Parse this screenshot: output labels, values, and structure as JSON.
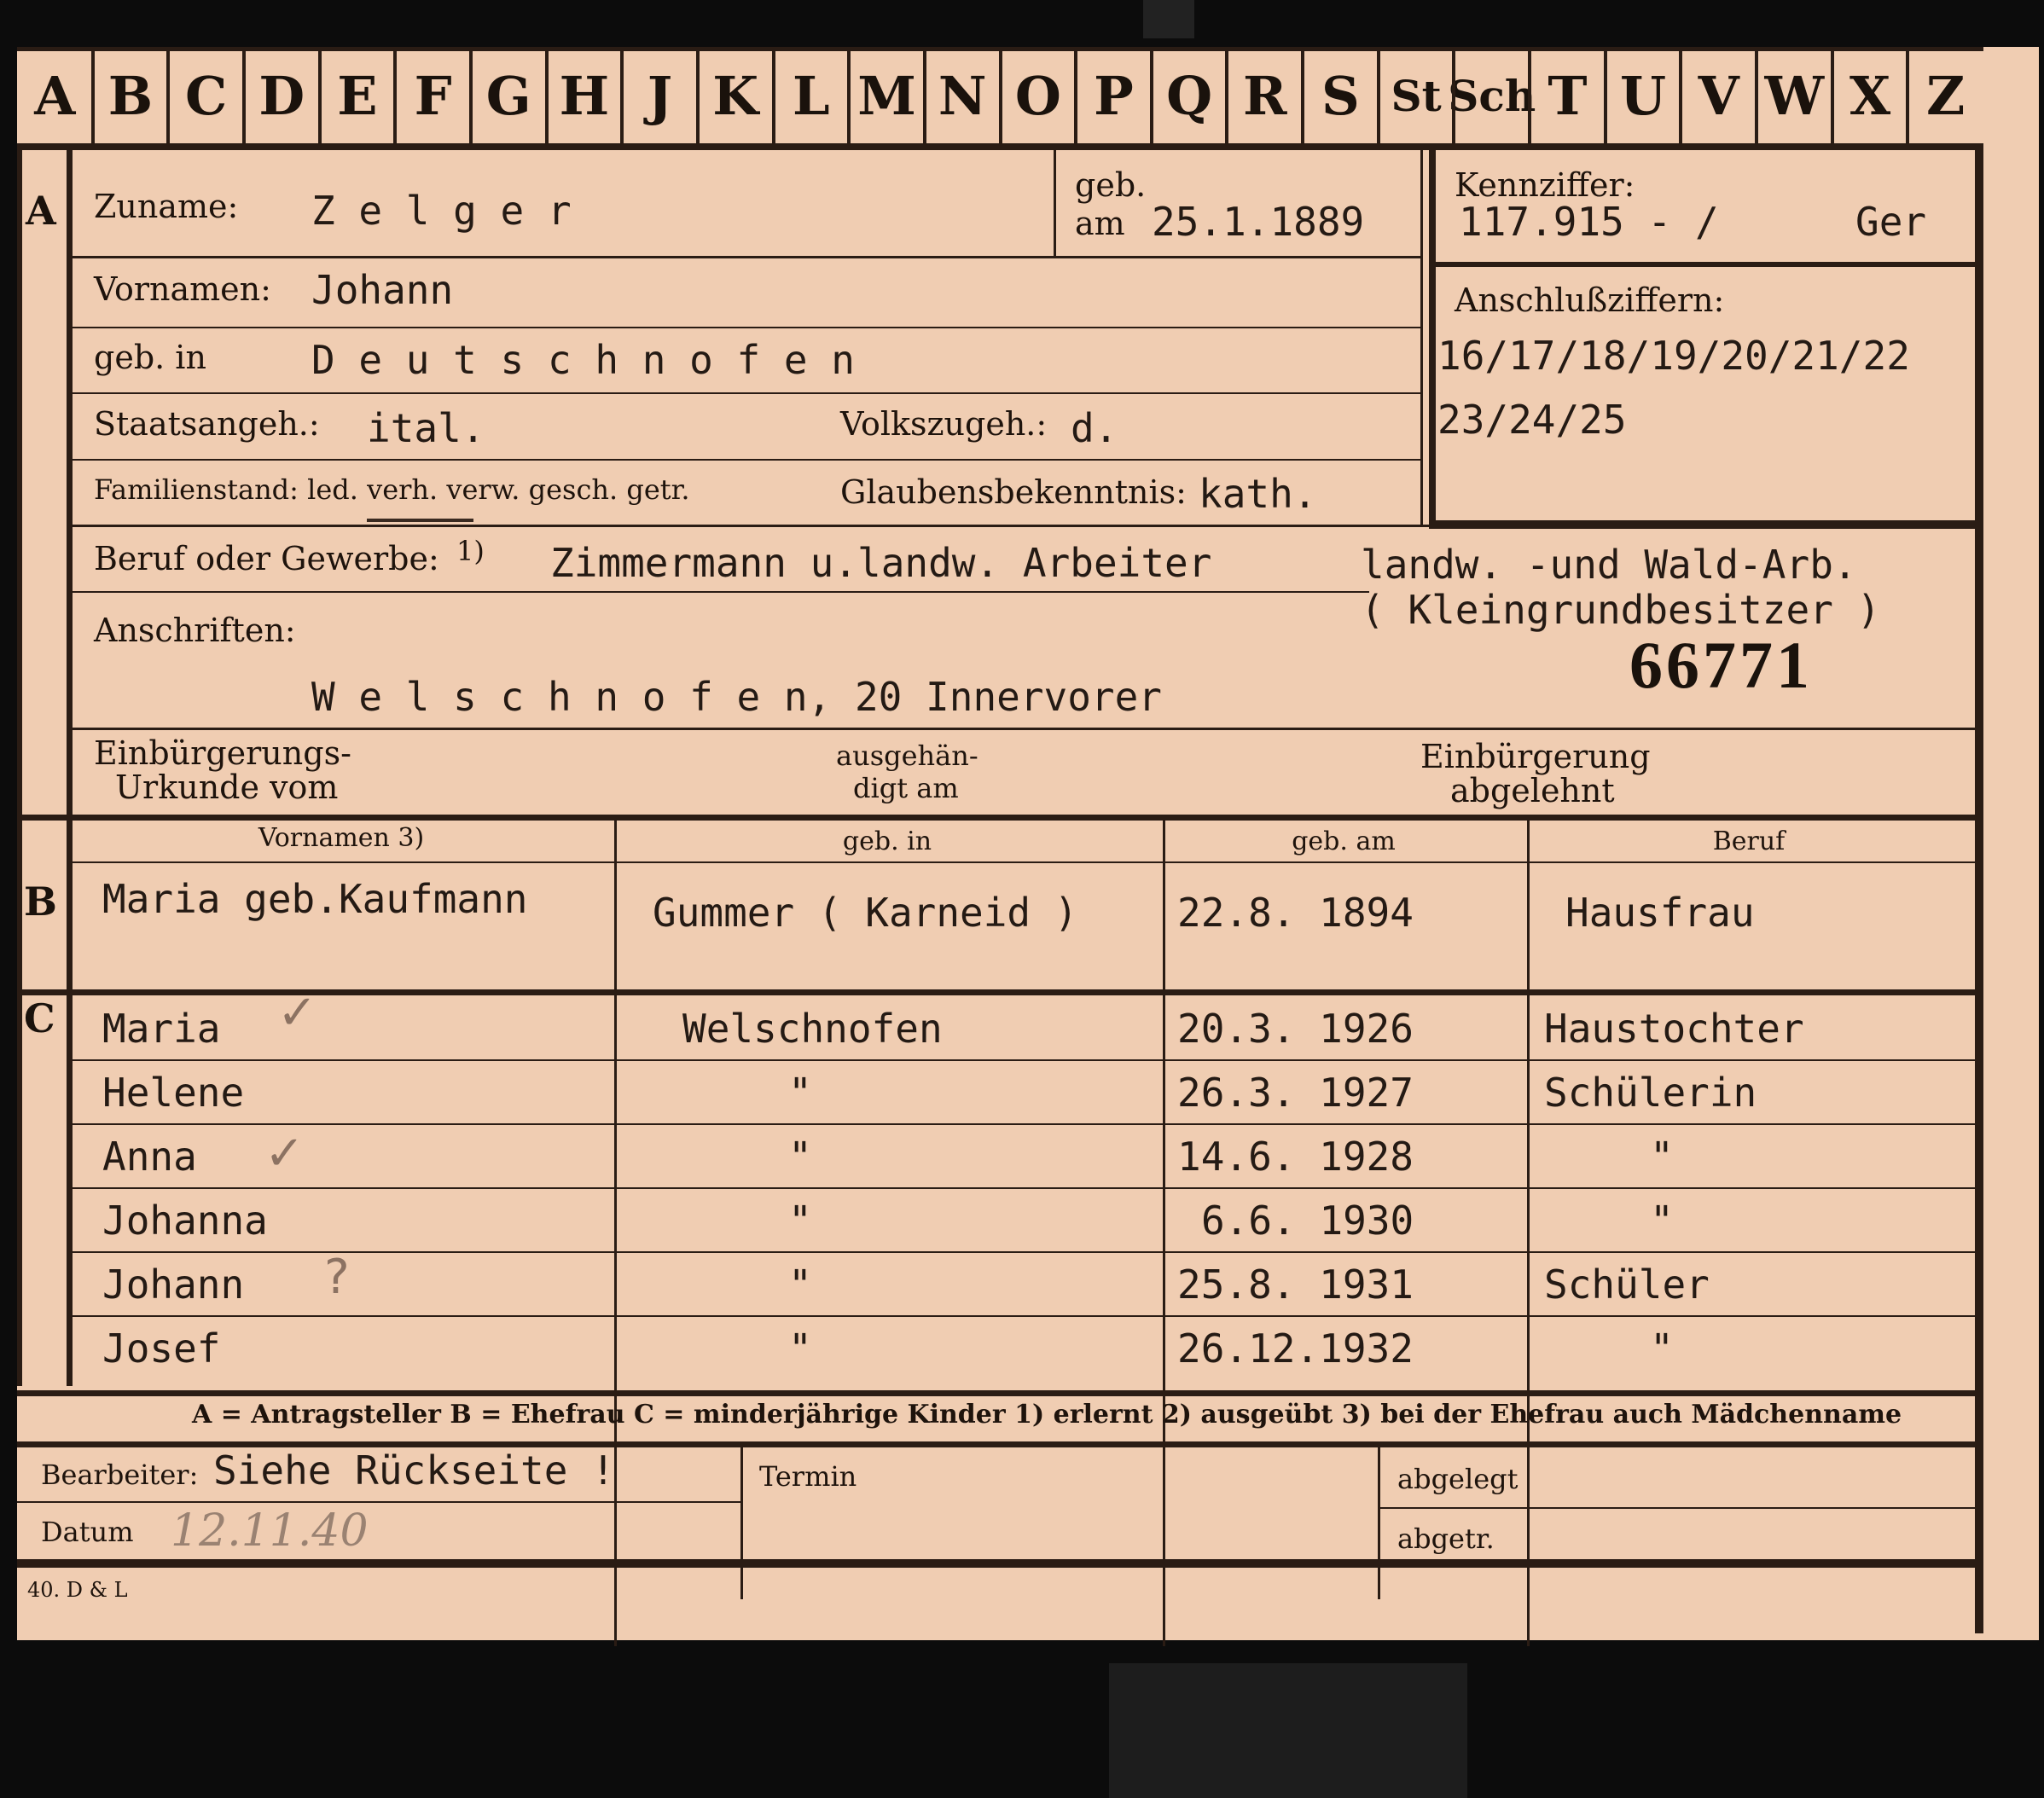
{
  "alphabet": [
    "A",
    "B",
    "C",
    "D",
    "E",
    "F",
    "G",
    "H",
    "J",
    "K",
    "L",
    "M",
    "N",
    "O",
    "P",
    "Q",
    "R",
    "S",
    "St",
    "Sch",
    "T",
    "U",
    "V",
    "W",
    "X",
    "Z"
  ],
  "section_markers": {
    "a": "A",
    "b": "B",
    "c": "C"
  },
  "applicant": {
    "surname_label": "Zuname:",
    "surname": "Z e l g e r",
    "birth_label_1": "geb.",
    "birth_label_2": "am",
    "birth_date": "25.1.1889",
    "firstname_label": "Vornamen:",
    "firstname": "Johann",
    "birthplace_label": "geb. in",
    "birthplace": "D e u t s c h n o f e n",
    "citizenship_label": "Staatsangeh.:",
    "citizenship": "ital.",
    "ethnicity_label": "Volkszugeh.:",
    "ethnicity": "d.",
    "family_label": "Familienstand: led. verh. verw. gesch. getr.",
    "religion_label": "Glaubensbekenntnis:",
    "religion": "kath.",
    "occupation_label": "Beruf oder Gewerbe:",
    "occupation_footnote": "1)",
    "occupation": "Zimmermann u.landw. Arbeiter",
    "occupation_2": "landw. -und Wald-Arb.",
    "occupation_3": "( Kleingrundbesitzer )",
    "address_label": "Anschriften:",
    "address": "W e l s c h n o f e n, 20 Innervorer",
    "number_stamp": "66771",
    "naturalization_label_1": "Einbürgerungs-",
    "naturalization_label_2": "Urkunde vom",
    "handed_label_1": "ausgehän-",
    "handed_label_2": "digt am",
    "rejected_label_1": "Einbürgerung",
    "rejected_label_2": "abgelehnt"
  },
  "ids": {
    "kennziffer_label": "Kennziffer:",
    "kennziffer": "117.915 - /",
    "kennziffer_suffix": "Ger",
    "anschluss_label": "Anschlußziffern:",
    "anschluss_1": "16/17/18/19/20/21/22",
    "anschluss_2": "23/24/25"
  },
  "table_headers": {
    "name": "Vornamen 3)",
    "place": "geb. in",
    "date": "geb. am",
    "job": "Beruf"
  },
  "spouse": {
    "name": "Maria geb.Kaufmann",
    "place": "Gummer ( Karneid )",
    "date": "22.8. 1894",
    "job": "Hausfrau"
  },
  "children": [
    {
      "name": "Maria",
      "place": "Welschnofen",
      "date": "20.3. 1926",
      "job": "Haustochter"
    },
    {
      "name": "Helene",
      "place": "\"",
      "date": "26.3. 1927",
      "job": "Schülerin"
    },
    {
      "name": "Anna",
      "place": "\"",
      "date": "14.6. 1928",
      "job": "\""
    },
    {
      "name": "Johanna",
      "place": "\"",
      "date": "6.6. 1930",
      "job": "\""
    },
    {
      "name": "Johann",
      "place": "\"",
      "date": "25.8. 1931",
      "job": "Schüler"
    },
    {
      "name": "Josef",
      "place": "\"",
      "date": "26.12.1932",
      "job": "\""
    }
  ],
  "marks": {
    "check": "✓",
    "question": "?"
  },
  "legend": "A = Antragsteller   B = Ehefrau   C = minderjährige Kinder   1) erlernt   2) ausgeübt   3) bei der Ehefrau auch Mädchenname",
  "footer": {
    "bearbeiter_label": "Bearbeiter:",
    "bearbeiter": "Siehe Rückseite !",
    "termin_label": "Termin",
    "abgelegt_label": "abgelegt",
    "datum_label": "Datum",
    "datum": "12.11.40",
    "abgetr_label": "abgetr.",
    "print_code": "40. D & L"
  }
}
